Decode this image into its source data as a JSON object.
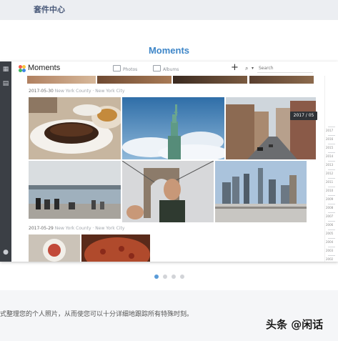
{
  "page": {
    "suite_title": "套件中心",
    "moments_heading": "Moments",
    "description": "式整理您的个人照片，从而使您可以十分详细地跟踪所有特殊时刻。",
    "watermark": "头条 @闲话",
    "carousel": {
      "count": 4,
      "active_index": 0
    }
  },
  "app": {
    "name": "Moments",
    "tabs": [
      {
        "label": "Photos",
        "icon": "photo-icon"
      },
      {
        "label": "Albums",
        "icon": "album-icon"
      }
    ],
    "add_label": "+",
    "search_placeholder": "Search",
    "left_bar_icons": [
      "grid-icon",
      "list-icon",
      "user-icon"
    ]
  },
  "groups": [
    {
      "date": "2017-05-30",
      "location": "New York County · New York City"
    },
    {
      "date": "2017-05-29",
      "location": "New York County · New York City"
    }
  ],
  "timeline": {
    "tooltip": "2017 / 05",
    "years": [
      "2017",
      "2016",
      "2015",
      "2014",
      "2013",
      "2012",
      "2011",
      "2010",
      "2009",
      "2008",
      "2007",
      "2006",
      "2005",
      "2004",
      "2003",
      "2002"
    ]
  },
  "photos": [
    {
      "name": "steak-dinner-photo"
    },
    {
      "name": "statue-of-liberty-photo"
    },
    {
      "name": "city-street-photo"
    },
    {
      "name": "waterfront-people-photo"
    },
    {
      "name": "bridge-selfie-photo"
    },
    {
      "name": "skyline-photo"
    },
    {
      "name": "coffee-photo"
    },
    {
      "name": "pizza-photo"
    }
  ]
}
